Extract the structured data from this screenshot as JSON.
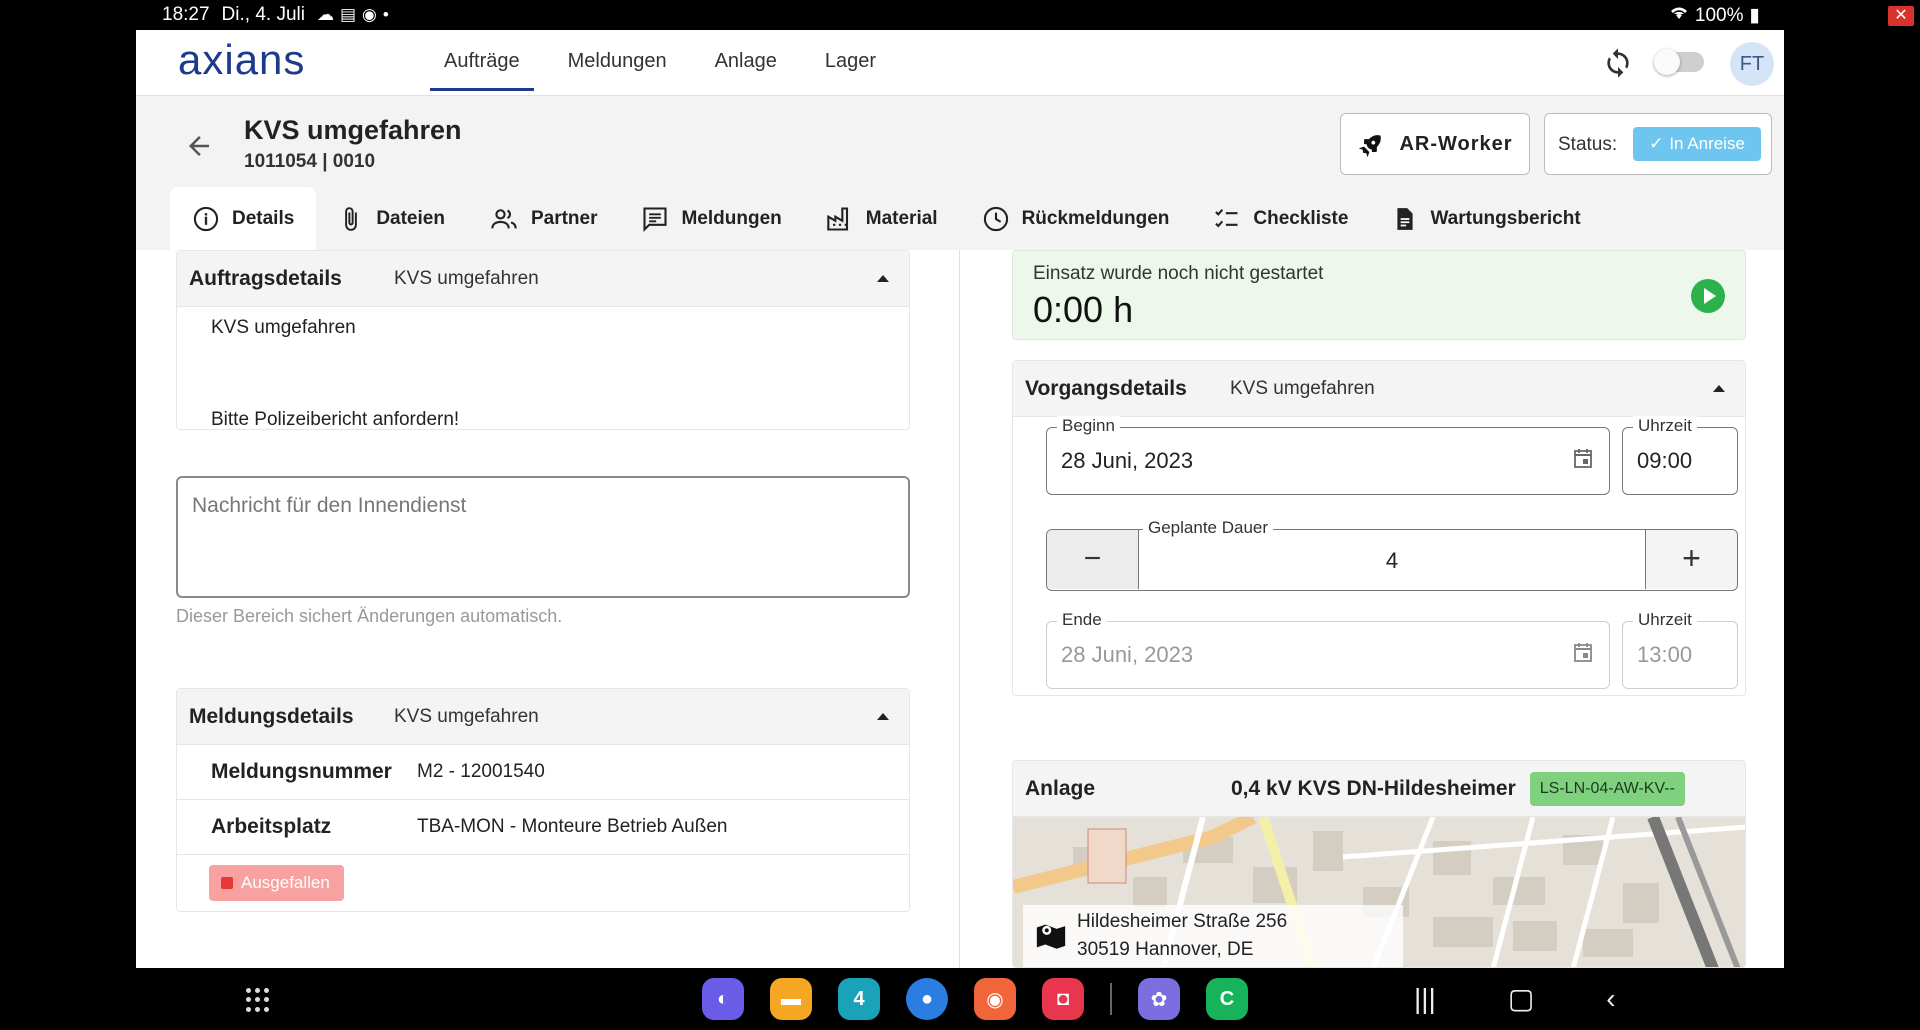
{
  "status_bar": {
    "time": "18:27",
    "date": "Di., 4. Juli",
    "battery": "100%",
    "icons": [
      "cloud-icon",
      "news-icon",
      "sync-status-icon",
      "dot-icon"
    ]
  },
  "app": {
    "logo_text": "axians",
    "logo_color": "#1e3a8a",
    "accent_color": "#6ec5ef",
    "nav": [
      {
        "label": "Aufträge",
        "active": true
      },
      {
        "label": "Meldungen",
        "active": false
      },
      {
        "label": "Anlage",
        "active": false
      },
      {
        "label": "Lager",
        "active": false
      }
    ],
    "avatar_initials": "FT",
    "toggle_on": false
  },
  "header": {
    "title": "KVS umgefahren",
    "number": "1011054 | 0010",
    "ar_worker_label": "AR-Worker",
    "status_label": "Status:",
    "status_value": "In Anreise"
  },
  "tabs": [
    {
      "label": "Details",
      "icon": "info-icon",
      "active": true
    },
    {
      "label": "Dateien",
      "icon": "paperclip-icon",
      "active": false
    },
    {
      "label": "Partner",
      "icon": "people-icon",
      "active": false
    },
    {
      "label": "Meldungen",
      "icon": "message-icon",
      "active": false
    },
    {
      "label": "Material",
      "icon": "factory-icon",
      "active": false
    },
    {
      "label": "Rückmeldungen",
      "icon": "clock-icon",
      "active": false
    },
    {
      "label": "Checkliste",
      "icon": "checklist-icon",
      "active": false
    },
    {
      "label": "Wartungsbericht",
      "icon": "document-icon",
      "active": false
    }
  ],
  "auftragsdetails": {
    "title": "Auftragsdetails",
    "subtitle": "KVS umgefahren",
    "line1": "KVS umgefahren",
    "line2": "Bitte Polizeibericht anfordern!"
  },
  "message": {
    "placeholder": "Nachricht für den Innendienst",
    "value": "",
    "hint": "Dieser Bereich sichert Änderungen automatisch."
  },
  "meldungsdetails": {
    "title": "Meldungsdetails",
    "subtitle": "KVS umgefahren",
    "rows": [
      {
        "key": "Meldungsnummer",
        "value": "M2 - 12001540"
      },
      {
        "key": "Arbeitsplatz",
        "value": "TBA-MON - Monteure Betrieb Außen"
      }
    ],
    "badge": "Ausgefallen"
  },
  "einsatz": {
    "label": "Einsatz wurde noch nicht gestartet",
    "time": "0:00 h"
  },
  "vorgangsdetails": {
    "title": "Vorgangsdetails",
    "subtitle": "KVS umgefahren",
    "begin_label": "Beginn",
    "begin_date": "28 Juni, 2023",
    "begin_time_label": "Uhrzeit",
    "begin_time": "09:00",
    "duration_label": "Geplante Dauer",
    "duration_value": "4",
    "minus_label": "−",
    "plus_label": "+",
    "end_label": "Ende",
    "end_date": "28 Juni, 2023",
    "end_time_label": "Uhrzeit",
    "end_time": "13:00"
  },
  "anlage": {
    "title": "Anlage",
    "name": "0,4 kV KVS DN-Hildesheimer",
    "code": "LS-LN-04-AW-KV--",
    "address_line1": "Hildesheimer Straße 256",
    "address_line2": "30519 Hannover, DE"
  },
  "navbar": {
    "dock": [
      {
        "icon": "internet-icon",
        "color": "#6b5ce7"
      },
      {
        "icon": "files-icon",
        "color": "#f5a623"
      },
      {
        "icon": "calendar-icon",
        "color": "#1aa3b8",
        "text": "4"
      },
      {
        "icon": "messages-icon",
        "color": "#2a7de1"
      },
      {
        "icon": "contacts-icon",
        "color": "#f0653a"
      },
      {
        "icon": "camera-icon",
        "color": "#e8364f"
      },
      {
        "icon": "gallery-icon",
        "color": "#7b6fe0"
      },
      {
        "icon": "phone-icon",
        "color": "#17b35a"
      }
    ]
  }
}
